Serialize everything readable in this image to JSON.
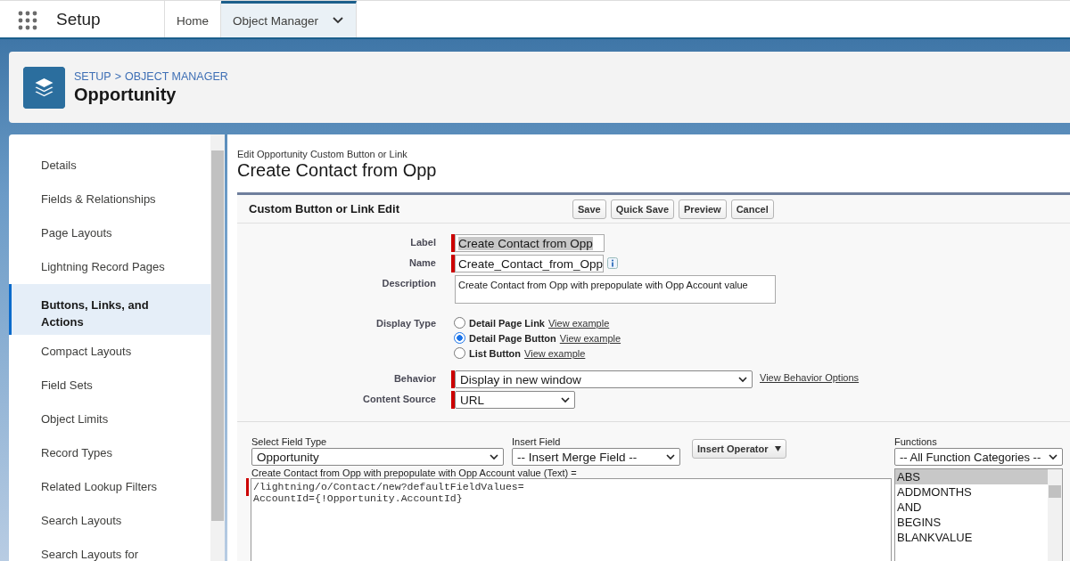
{
  "app_bar": {
    "title": "Setup",
    "tabs": [
      {
        "label": "Home",
        "selected": false,
        "menu": false
      },
      {
        "label": "Object Manager",
        "selected": true,
        "menu": true
      }
    ]
  },
  "header": {
    "crumbs": [
      "SETUP",
      "OBJECT MANAGER"
    ],
    "separator": ">",
    "title": "Opportunity"
  },
  "sidebar": {
    "items": [
      {
        "label": "Details",
        "selected": false
      },
      {
        "label": "Fields & Relationships",
        "selected": false
      },
      {
        "label": "Page Layouts",
        "selected": false
      },
      {
        "label": "Lightning Record Pages",
        "selected": false
      },
      {
        "label": "Buttons, Links, and Actions",
        "selected": true
      },
      {
        "label": "Compact Layouts",
        "selected": false
      },
      {
        "label": "Field Sets",
        "selected": false
      },
      {
        "label": "Object Limits",
        "selected": false
      },
      {
        "label": "Record Types",
        "selected": false
      },
      {
        "label": "Related Lookup Filters",
        "selected": false
      },
      {
        "label": "Search Layouts",
        "selected": false
      },
      {
        "label": "Search Layouts for",
        "selected": false
      }
    ]
  },
  "page": {
    "subtitle": "Edit Opportunity Custom Button or Link",
    "title": "Create Contact from Opp"
  },
  "form": {
    "title": "Custom Button or Link Edit",
    "buttons": [
      "Save",
      "Quick Save",
      "Preview",
      "Cancel"
    ],
    "fields": [
      {
        "kind": "text",
        "label": "Label",
        "value": "Create Contact from Opp",
        "required": true,
        "highlighted": true,
        "info": false
      },
      {
        "kind": "text",
        "label": "Name",
        "value": "Create_Contact_from_Opp",
        "required": true,
        "highlighted": false,
        "info": true
      },
      {
        "kind": "textarea",
        "label": "Description",
        "value": "Create Contact from Opp with prepopulate with Opp Account value",
        "required": false
      },
      {
        "kind": "radio",
        "label": "Display Type",
        "options": [
          {
            "label": "Detail Page Link",
            "link": "View example",
            "selected": false
          },
          {
            "label": "Detail Page Button",
            "link": "View example",
            "selected": true
          },
          {
            "label": "List Button",
            "link": "View example",
            "selected": false
          }
        ]
      },
      {
        "kind": "select",
        "label": "Behavior",
        "value": "Display in new window",
        "required": true,
        "link": "View Behavior Options"
      },
      {
        "kind": "select",
        "label": "Content Source",
        "value": "URL",
        "required": true
      }
    ]
  },
  "formula": {
    "field_type": {
      "label": "Select Field Type",
      "value": "Opportunity"
    },
    "insert_field": {
      "label": "Insert Field",
      "value": "-- Insert Merge Field --"
    },
    "operator_button": "Insert Operator",
    "functions": {
      "label": "Functions",
      "value": "-- All Function Categories --",
      "items": [
        {
          "label": "ABS",
          "selected": true
        },
        {
          "label": "ADDMONTHS",
          "selected": false
        },
        {
          "label": "AND",
          "selected": false
        },
        {
          "label": "BEGINS",
          "selected": false
        },
        {
          "label": "BLANKVALUE",
          "selected": false
        }
      ]
    },
    "caption": "Create Contact from Opp with prepopulate with Opp Account value (Text) =",
    "required": true,
    "code": [
      "/lightning/o/Contact/new?defaultFieldValues=",
      "AccountId={!Opportunity.AccountId}"
    ]
  }
}
